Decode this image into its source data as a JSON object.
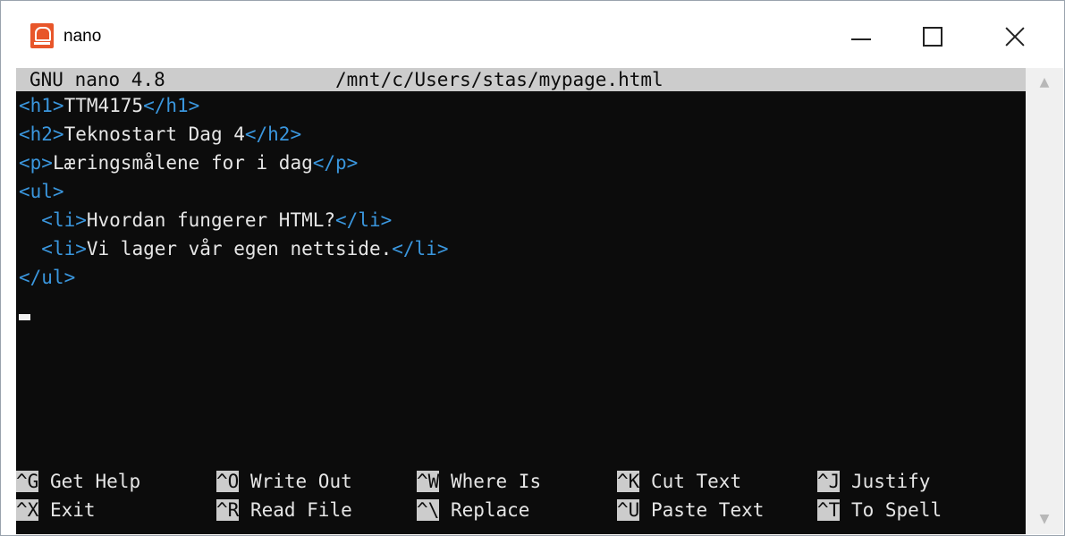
{
  "window": {
    "title": "nano"
  },
  "editor": {
    "version": "GNU nano 4.8",
    "file_path": "/mnt/c/Users/stas/mypage.html",
    "lines": [
      [
        {
          "t": "<h1>",
          "tag": true
        },
        {
          "t": "TTM4175",
          "tag": false
        },
        {
          "t": "</h1>",
          "tag": true
        }
      ],
      [
        {
          "t": "<h2>",
          "tag": true
        },
        {
          "t": "Teknostart Dag 4",
          "tag": false
        },
        {
          "t": "</h2>",
          "tag": true
        }
      ],
      [
        {
          "t": "<p>",
          "tag": true
        },
        {
          "t": "Læringsmålene for i dag",
          "tag": false
        },
        {
          "t": "</p>",
          "tag": true
        }
      ],
      [
        {
          "t": "<ul>",
          "tag": true
        }
      ],
      [
        {
          "t": "  ",
          "tag": false
        },
        {
          "t": "<li>",
          "tag": true
        },
        {
          "t": "Hvordan fungerer HTML?",
          "tag": false
        },
        {
          "t": "</li>",
          "tag": true
        }
      ],
      [
        {
          "t": "  ",
          "tag": false
        },
        {
          "t": "<li>",
          "tag": true
        },
        {
          "t": "Vi lager vår egen nettside.",
          "tag": false
        },
        {
          "t": "</li>",
          "tag": true
        }
      ],
      [
        {
          "t": "</ul>",
          "tag": true
        }
      ]
    ]
  },
  "shortcuts": [
    {
      "key": "^G",
      "label": "Get Help"
    },
    {
      "key": "^O",
      "label": "Write Out"
    },
    {
      "key": "^W",
      "label": "Where Is"
    },
    {
      "key": "^K",
      "label": "Cut Text"
    },
    {
      "key": "^J",
      "label": "Justify"
    },
    {
      "key": "^X",
      "label": "Exit"
    },
    {
      "key": "^R",
      "label": "Read File"
    },
    {
      "key": "^\\",
      "label": "Replace"
    },
    {
      "key": "^U",
      "label": "Paste Text"
    },
    {
      "key": "^T",
      "label": "To Spell"
    }
  ],
  "colors": {
    "tag": "#3a96dd",
    "text": "#e6e6e6",
    "terminal_bg": "#0c0c0c",
    "header_bg": "#cccccc"
  }
}
